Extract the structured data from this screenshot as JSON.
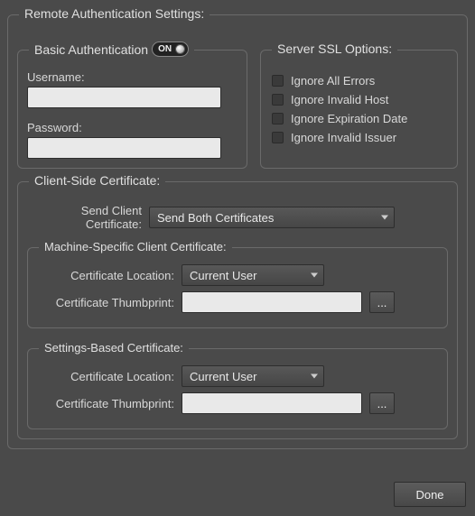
{
  "remote_auth": {
    "title": "Remote Authentication Settings:",
    "basic_auth": {
      "title": "Basic Authentication",
      "toggle_label": "ON",
      "username_label": "Username:",
      "username_value": "",
      "password_label": "Password:",
      "password_value": ""
    },
    "ssl_options": {
      "title": "Server SSL Options:",
      "items": [
        {
          "label": "Ignore All Errors",
          "checked": false
        },
        {
          "label": "Ignore Invalid Host",
          "checked": false
        },
        {
          "label": "Ignore Expiration Date",
          "checked": false
        },
        {
          "label": "Ignore Invalid Issuer",
          "checked": false
        }
      ]
    },
    "client_side": {
      "title": "Client-Side Certificate:",
      "send_label": "Send Client Certificate:",
      "send_value": "Send Both Certificates",
      "machine": {
        "title": "Machine-Specific Client Certificate:",
        "location_label": "Certificate Location:",
        "location_value": "Current User",
        "thumbprint_label": "Certificate Thumbprint:",
        "thumbprint_value": "",
        "browse_label": "..."
      },
      "settings": {
        "title": "Settings-Based Certificate:",
        "location_label": "Certificate Location:",
        "location_value": "Current User",
        "thumbprint_label": "Certificate Thumbprint:",
        "thumbprint_value": "",
        "browse_label": "..."
      }
    }
  },
  "buttons": {
    "done": "Done"
  }
}
